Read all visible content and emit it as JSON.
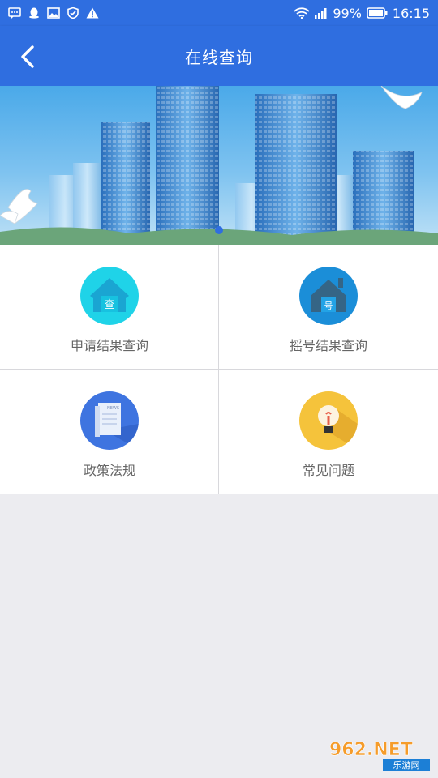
{
  "status_bar": {
    "battery": "99%",
    "time": "16:15"
  },
  "header": {
    "title": "在线查询"
  },
  "menu": {
    "items": [
      {
        "label": "申请结果查询",
        "badge": "查"
      },
      {
        "label": "摇号结果查询",
        "badge": "号"
      },
      {
        "label": "政策法规",
        "badge": "NEWS"
      },
      {
        "label": "常见问题"
      }
    ]
  },
  "watermark": {
    "brand": "962.NET",
    "sub": "乐游网"
  },
  "colors": {
    "primary": "#2f6ee0",
    "cyan": "#1fd3e8",
    "blue_dark": "#1b8ed8",
    "royal": "#3e74e0",
    "amber": "#f5c33b"
  }
}
